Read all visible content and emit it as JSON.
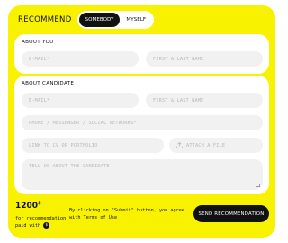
{
  "header": {
    "title": "RECOMMEND",
    "toggle": {
      "options": [
        "SOMEBODY",
        "MYSELF"
      ],
      "selected": "SOMEBODY"
    }
  },
  "about_you": {
    "title": "ABOUT YOU",
    "email_placeholder": "E-MAIL*",
    "name_placeholder": "FIRST & LAST NAME"
  },
  "about_candidate": {
    "title": "ABOUT CANDIDATE",
    "email_placeholder": "E-MAIL*",
    "name_placeholder": "FIRST & LAST NAME",
    "phone_placeholder": "PHONE / MESSENGER / SOCIAL NETWORKS*",
    "cv_placeholder": "LINK TO CV OR PORTFOLIO",
    "attach_label": "ATTACH A FILE",
    "about_placeholder": "TELL US ABOUT THE CANDIDATE"
  },
  "footer": {
    "amount": "1200",
    "currency": "$",
    "amount_caption": "for recommendation paid with",
    "note_prefix": "By clicking on \"Submit\" button, you agree with",
    "terms_link": "Terms of Use",
    "send_button": "SEND RECOMMENDATION"
  },
  "colors": {
    "background": "#f8f200",
    "accent": "#111111"
  }
}
